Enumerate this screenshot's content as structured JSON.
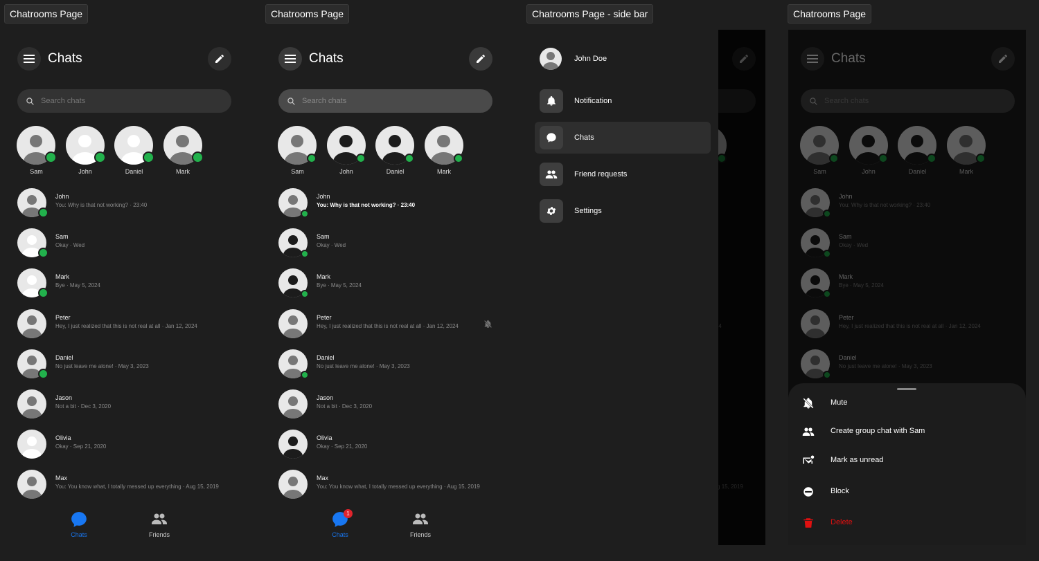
{
  "frames": [
    {
      "label": "Chatrooms Page"
    },
    {
      "label": "Chatrooms Page"
    },
    {
      "label": "Chatrooms Page - side bar"
    },
    {
      "label": "Chatrooms Page"
    }
  ],
  "header": {
    "title": "Chats",
    "menu_icon": "menu-icon",
    "compose_icon": "pencil-icon"
  },
  "search": {
    "placeholder": "Search chats"
  },
  "stories": [
    {
      "name": "Sam",
      "online": true
    },
    {
      "name": "John",
      "online": true
    },
    {
      "name": "Daniel",
      "online": true
    },
    {
      "name": "Mark",
      "online": true
    }
  ],
  "chats": [
    {
      "name": "John",
      "preview": "You: Why is that not working? · 23:40",
      "online": true
    },
    {
      "name": "Sam",
      "preview": "Okay · Wed",
      "online": true
    },
    {
      "name": "Mark",
      "preview": "Bye · May 5, 2024",
      "online": true
    },
    {
      "name": "Peter",
      "preview": "Hey, I just realized that this is not real at all · Jan 12, 2024",
      "online": false,
      "muted_icon": "bell-off-icon"
    },
    {
      "name": "Daniel",
      "preview": "No just leave me alone! · May 3, 2023",
      "online": true
    },
    {
      "name": "Jason",
      "preview": "Not a bit · Dec 3, 2020",
      "online": false
    },
    {
      "name": "Olivia",
      "preview": "Okay · Sep 21, 2020",
      "online": false
    },
    {
      "name": "Max",
      "preview": "You: You know what, I totally messed up everything · Aug 15, 2019",
      "online": false
    }
  ],
  "tabs": [
    {
      "label": "Chats",
      "icon": "chat-bubble-icon",
      "active": true,
      "badge": "1"
    },
    {
      "label": "Friends",
      "icon": "people-icon",
      "active": false
    }
  ],
  "sidebar": {
    "user": "John Doe",
    "items": [
      {
        "label": "Notification",
        "icon": "bell-icon"
      },
      {
        "label": "Chats",
        "icon": "chat-bubble-icon",
        "active": true
      },
      {
        "label": "Friend requests",
        "icon": "people-icon"
      },
      {
        "label": "Settings",
        "icon": "gear-icon"
      }
    ]
  },
  "sheet": {
    "items": [
      {
        "label": "Mute",
        "icon": "bell-off-icon"
      },
      {
        "label": "Create group chat with Sam",
        "icon": "people-icon"
      },
      {
        "label": "Mark as unread",
        "icon": "mail-unread-icon"
      },
      {
        "label": "Block",
        "icon": "block-icon"
      },
      {
        "label": "Delete",
        "icon": "trash-icon",
        "color": "#e01010"
      }
    ]
  },
  "colors": {
    "accent": "#1877f2",
    "online": "#22b14c",
    "danger": "#e01010",
    "badge": "#e0242c"
  }
}
